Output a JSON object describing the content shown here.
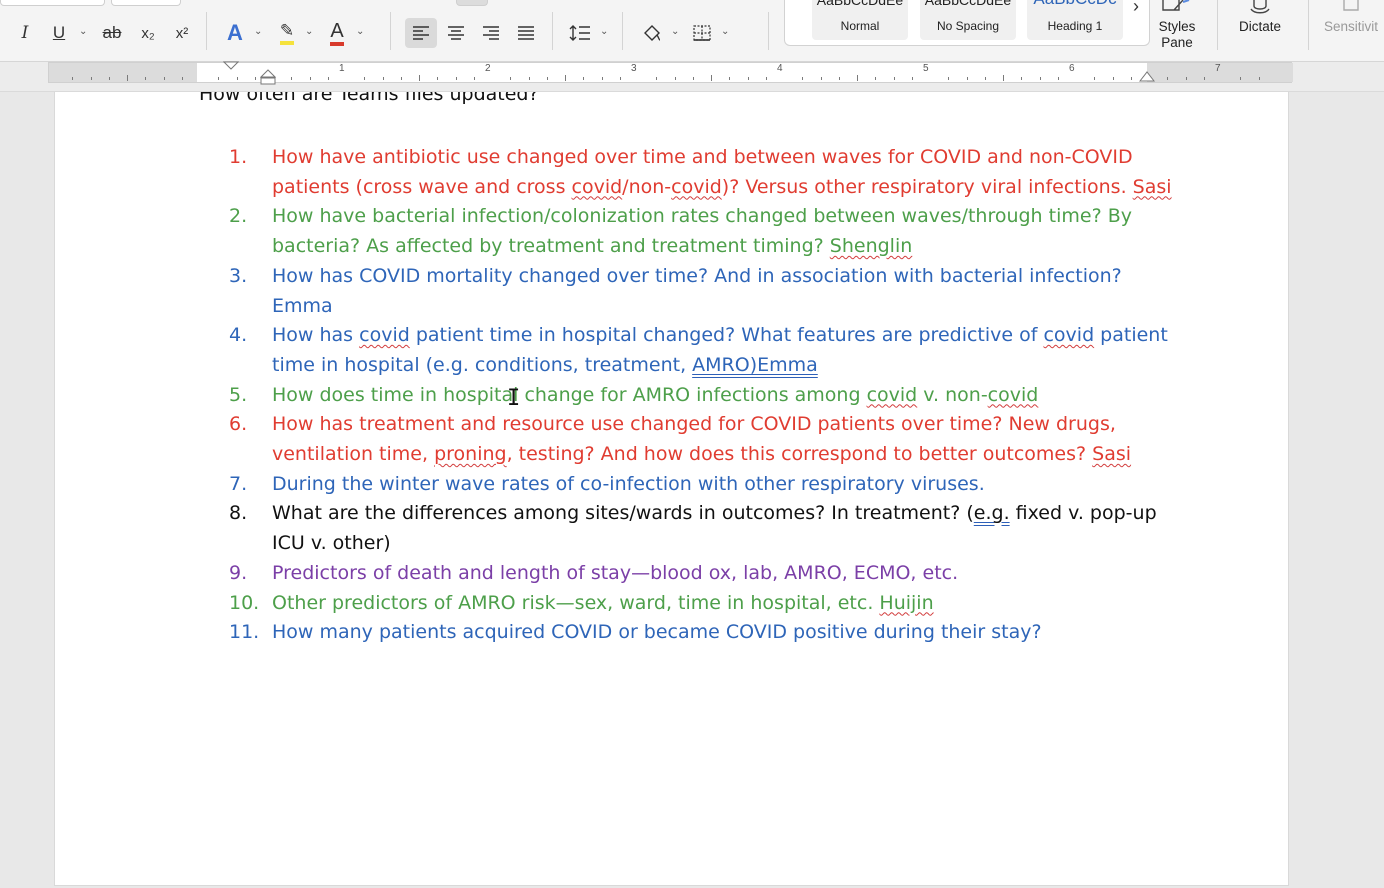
{
  "toolbar": {
    "italic": "I",
    "underline": "U",
    "strike": "ab",
    "subscript": "x₂",
    "superscript": "x²",
    "text_effects": "A",
    "highlight": "✎",
    "font_color": "A",
    "caret": "⌄",
    "styles_more": "›",
    "styles": [
      {
        "preview": "AaBbCcDdEe",
        "name": "Normal"
      },
      {
        "preview": "AaBbCcDdEe",
        "name": "No Spacing"
      },
      {
        "preview": "AaBbCcDc",
        "name": "Heading 1"
      }
    ],
    "styles_pane_label": "Styles\nPane",
    "dictate_label": "Dictate",
    "sensitivity_label": "Sensitivit"
  },
  "ruler": {
    "numbers": [
      "1",
      "2",
      "3",
      "4",
      "5",
      "6",
      "7"
    ]
  },
  "document": {
    "heading": "How often are Teams files updated?",
    "colors": {
      "red": "#e03c31",
      "green": "#4d9f4a",
      "blue": "#2e65b8",
      "black": "#111111",
      "purple": "#7b3fa7"
    },
    "items": [
      {
        "number": "1.",
        "color": "red",
        "segments": [
          {
            "text": "How have antibiotic use changed over time and between waves for COVID and non-COVID patients (cross wave and cross "
          },
          {
            "text": "covid",
            "mark": "wavy"
          },
          {
            "text": "/non-"
          },
          {
            "text": "covid",
            "mark": "wavy"
          },
          {
            "text": ")?  Versus other respiratory viral infections. "
          },
          {
            "text": "Sasi",
            "mark": "wavy"
          }
        ]
      },
      {
        "number": "2.",
        "color": "green",
        "segments": [
          {
            "text": "How have bacterial infection/colonization rates changed between waves/through time?  By bacteria?  As affected by treatment and treatment timing? "
          },
          {
            "text": "Shenglin",
            "mark": "wavy"
          }
        ]
      },
      {
        "number": "3.",
        "color": "blue",
        "segments": [
          {
            "text": "How has COVID mortality changed over time?  And in association with bacterial infection?  Emma"
          }
        ]
      },
      {
        "number": "4.",
        "color": "blue",
        "segments": [
          {
            "text": "How has "
          },
          {
            "text": "covid",
            "mark": "wavy"
          },
          {
            "text": " patient time in hospital changed?  What features are predictive of "
          },
          {
            "text": "covid",
            "mark": "wavy"
          },
          {
            "text": " patient time in hospital (e.g. conditions, treatment, "
          },
          {
            "text": "AMRO)Emma",
            "mark": "dbl"
          }
        ]
      },
      {
        "number": "5.",
        "color": "green",
        "segments": [
          {
            "text": "How does time in hospital change for AMRO infections among "
          },
          {
            "text": "covid",
            "mark": "wavy"
          },
          {
            "text": " v. non-"
          },
          {
            "text": "covid",
            "mark": "wavy"
          }
        ]
      },
      {
        "number": "6.",
        "color": "red",
        "segments": [
          {
            "text": "How has treatment and resource use changed for COVID patients over time?  New drugs, ventilation time, "
          },
          {
            "text": "proning",
            "mark": "wavy"
          },
          {
            "text": ", testing?  And how does this correspond to better outcomes?  "
          },
          {
            "text": "Sasi",
            "mark": "wavy"
          }
        ]
      },
      {
        "number": "7.",
        "color": "blue",
        "segments": [
          {
            "text": "During the winter wave rates of co-infection with other respiratory viruses."
          }
        ]
      },
      {
        "number": "8.",
        "color": "black",
        "segments": [
          {
            "text": "What are the differences among sites/wards in outcomes?  In treatment?  ("
          },
          {
            "text": "e.g.",
            "mark": "dbl"
          },
          {
            "text": " fixed v. pop-up ICU v. other)"
          }
        ]
      },
      {
        "number": "9.",
        "color": "purple",
        "segments": [
          {
            "text": "Predictors of death and length of stay—blood ox, lab, AMRO, ECMO, etc."
          }
        ]
      },
      {
        "number": "10.",
        "color": "green",
        "segments": [
          {
            "text": "Other predictors of AMRO risk—sex, ward, time in hospital, etc.  "
          },
          {
            "text": "Huijin",
            "mark": "wavy"
          }
        ]
      },
      {
        "number": "11.",
        "color": "blue",
        "segments": [
          {
            "text": "How many patients acquired COVID or became COVID positive during their stay?"
          }
        ]
      }
    ]
  }
}
